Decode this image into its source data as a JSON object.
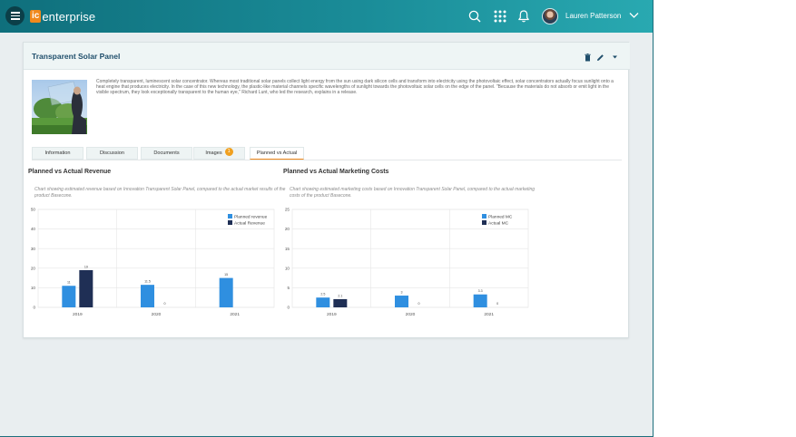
{
  "app": {
    "logo_badge": "ic",
    "logo_text": "enterprise",
    "user_name": "Lauren Patterson"
  },
  "card": {
    "title": "Transparent Solar Panel",
    "description": "Completely transparent, luminescent solar concentrator. Whereas most traditional solar panels collect light energy from the sun using dark silicon cells and transform into electricity using the photovoltaic effect, solar concentrators actually focus sunlight onto a heat engine that produces electricity. In the case of this new technology, the plastic-like material channels specific wavelengths of sunlight towards the photovoltaic solar cells on the edge of the panel. \"Because the materials do not absorb or emit light in the visible spectrum, they look exceptionally transparent to the human eye,\" Richard Lunt, who led the research, explains in a release."
  },
  "tabs": [
    {
      "label": "Information",
      "active": false
    },
    {
      "label": "Discussion",
      "active": false
    },
    {
      "label": "Documents",
      "active": false
    },
    {
      "label": "Images",
      "active": false,
      "badge": "1"
    },
    {
      "label": "Planned vs Actual",
      "active": true
    }
  ],
  "colors": {
    "accent": "#f0891c",
    "planned": "#2f8fe0",
    "actual": "#1f2f55",
    "title": "#1f4e6b"
  },
  "chart_data": [
    {
      "type": "bar",
      "title": "Planned vs Actual Revenue",
      "description": "Chart showing estimated revenue based on Innovation Transparent Solar Panel, compared to the actual market results of the product Basecone.",
      "categories": [
        "2019",
        "2020",
        "2021"
      ],
      "series": [
        {
          "name": "Planned revenue",
          "values": [
            11,
            11.5,
            15
          ]
        },
        {
          "name": "Actual Revenue",
          "values": [
            19,
            0,
            null
          ]
        }
      ],
      "data_labels": [
        [
          "11",
          "19"
        ],
        [
          "11.5",
          "0"
        ],
        [
          "15",
          ""
        ]
      ],
      "ylim": [
        0,
        50
      ],
      "yticks": [
        0,
        10,
        20,
        30,
        40,
        50
      ],
      "grid": true,
      "legend": "top-right"
    },
    {
      "type": "bar",
      "title": "Planned vs Actual Marketing Costs",
      "description": "Chart showing estimated marketing costs based on Innovation Transparent Solar Panel, compared to the actual marketing costs of the product Basecone.",
      "categories": [
        "2019",
        "2020",
        "2021"
      ],
      "series": [
        {
          "name": "Planned MC",
          "values": [
            2.5,
            3,
            3.3
          ]
        },
        {
          "name": "Actual MC",
          "values": [
            2.1,
            0,
            0
          ]
        }
      ],
      "data_labels": [
        [
          "2.5",
          "2.1"
        ],
        [
          "3",
          "0"
        ],
        [
          "3.3",
          "0"
        ]
      ],
      "ylim": [
        0,
        25
      ],
      "yticks": [
        0,
        5,
        10,
        15,
        20,
        25
      ],
      "grid": true,
      "legend": "top-right"
    }
  ]
}
